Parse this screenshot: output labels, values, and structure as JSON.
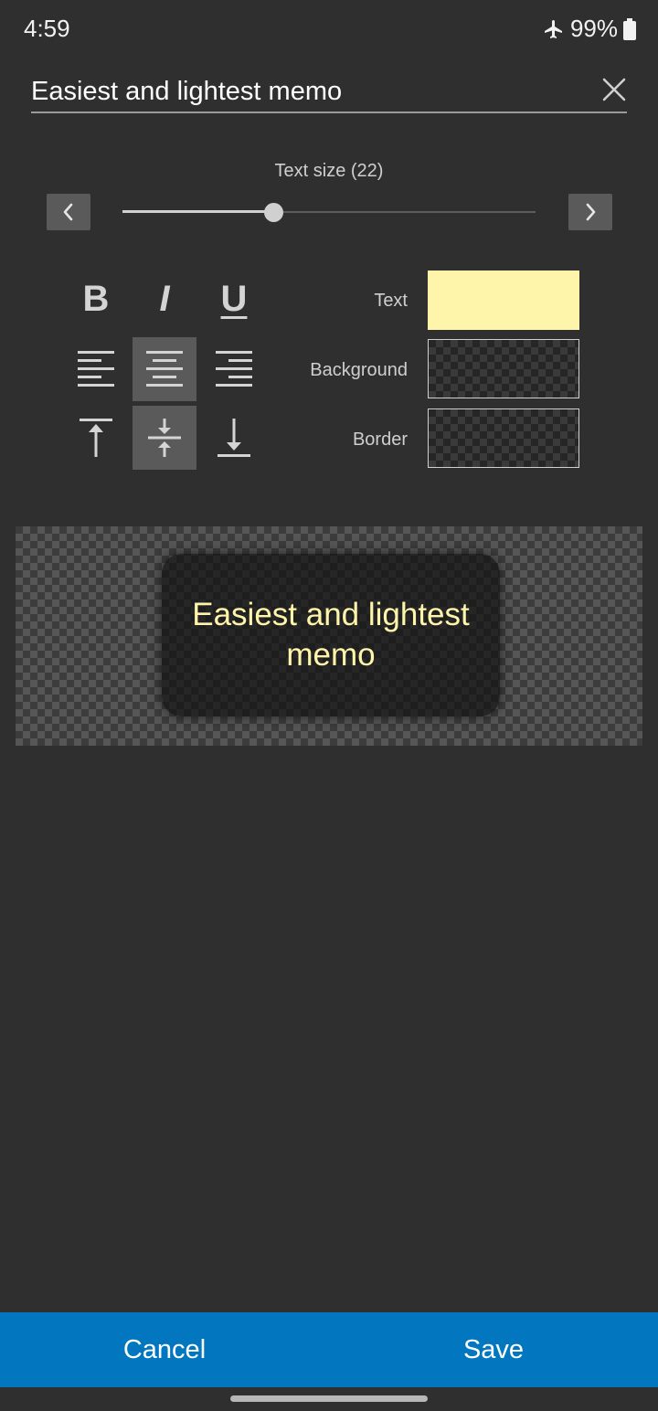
{
  "status": {
    "time": "4:59",
    "battery": "99%",
    "icons": [
      "airplane-mode-icon",
      "battery-icon"
    ]
  },
  "editor": {
    "title_value": "Easiest and lightest memo",
    "clear_icon": "close-icon"
  },
  "text_size": {
    "label": "Text size (22)",
    "value": 22,
    "fraction": 0.366,
    "prev_icon": "chevron-left-icon",
    "next_icon": "chevron-right-icon"
  },
  "format": {
    "bold": "B",
    "italic": "I",
    "underline": "U",
    "active": [
      "align-center",
      "valign-middle"
    ]
  },
  "colors": {
    "text_label": "Text",
    "background_label": "Background",
    "border_label": "Border",
    "text_color": "#fff5aa",
    "background_color": "transparent",
    "border_color": "transparent"
  },
  "preview": {
    "text": "Easiest and lightest memo"
  },
  "actions": {
    "cancel": "Cancel",
    "save": "Save",
    "bar_color": "#0277c0"
  }
}
